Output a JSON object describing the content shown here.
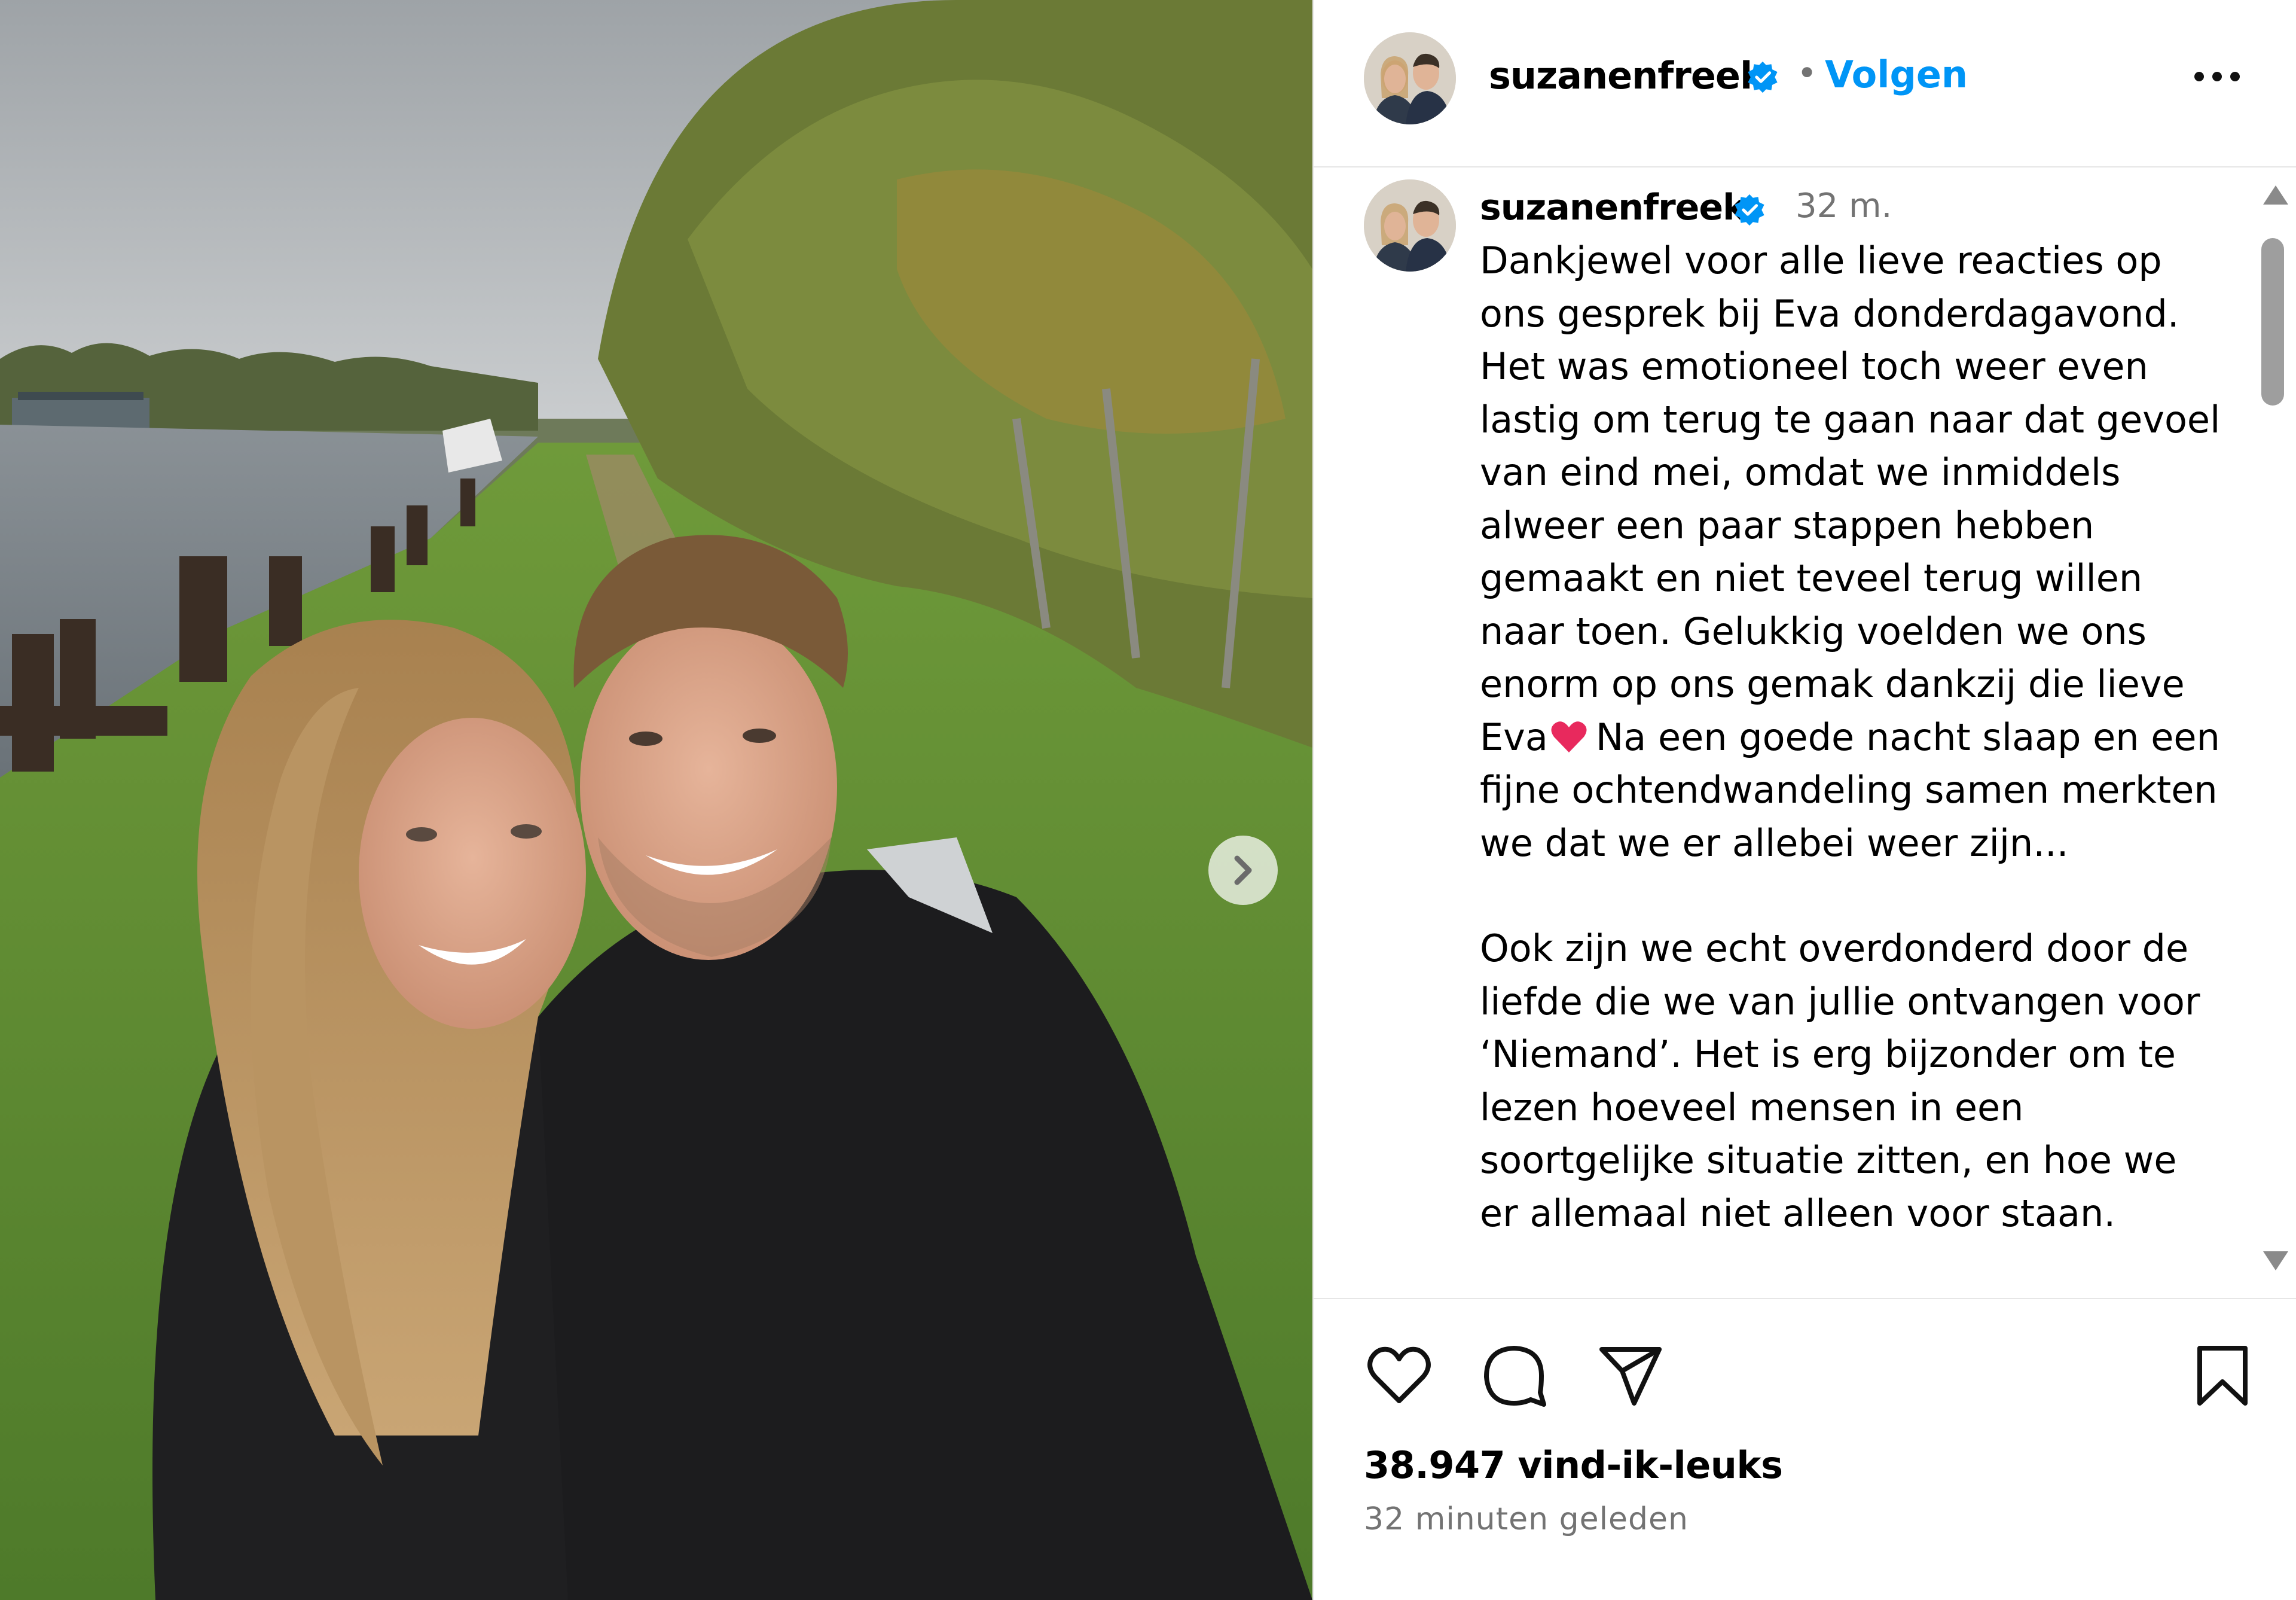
{
  "post": {
    "username": "suzanenfreek",
    "follow_label": "Volgen",
    "separator_dot": "•",
    "caption_time": "32 m.",
    "caption_paragraph_1a": "Dankjewel voor alle lieve reacties op ons gesprek bij Eva donderdagavond. Het was emotioneel toch weer even lastig om terug te gaan naar dat gevoel van eind mei, omdat we inmiddels alweer een paar stappen hebben gemaakt en niet teveel terug willen naar toen. Gelukkig voelden we ons enorm op ons gemak dankzij die lieve Eva",
    "caption_paragraph_1b": "Na een goede nacht slaap en een fijne ochtendwandeling samen merkten we dat we er allebei weer zijn...",
    "caption_paragraph_2": "Ook zijn we echt overdonderd door de liefde die we van jullie ontvangen voor ‘Niemand’. Het is erg bijzonder om te lezen hoeveel mensen in een soortgelijke situatie zitten, en hoe we er allemaal niet alleen voor staan.",
    "likes": "38.947 vind-ik-leuks",
    "timestamp": "32 minuten geleden"
  },
  "icons": {
    "verified": "verified-badge-icon",
    "more": "more-options-icon",
    "like": "heart-icon",
    "comment": "comment-icon",
    "share": "paper-plane-icon",
    "save": "bookmark-icon",
    "next": "chevron-right-icon",
    "emoji": "red-heart-emoji"
  },
  "colors": {
    "link_blue": "#0095f6",
    "verified_blue": "#0095f6",
    "secondary_text": "#737373",
    "heart_emoji": "#e8295d"
  }
}
